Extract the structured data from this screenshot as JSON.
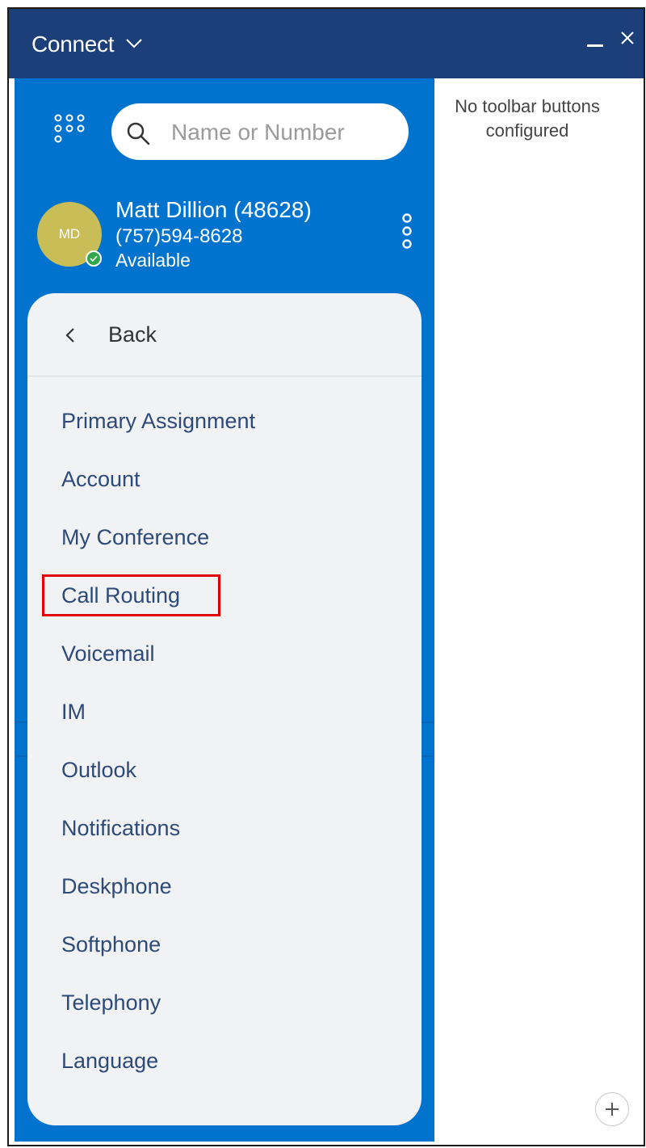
{
  "window": {
    "title": "Connect",
    "colors": {
      "titlebar": "#1c3f7a",
      "panel": "#0073cf",
      "menu_bg": "#f1f2f4",
      "menu_text": "#2d4a78",
      "highlight": "#e00000",
      "presence": "#2ea84a"
    }
  },
  "search": {
    "placeholder": "Name or Number",
    "icon": "search-icon"
  },
  "user": {
    "initials": "MD",
    "name": "Matt Dillion (48628)",
    "phone": "(757)594-8628",
    "status": "Available"
  },
  "menu": {
    "back_label": "Back",
    "items": [
      {
        "label": "Primary Assignment"
      },
      {
        "label": "Account"
      },
      {
        "label": "My Conference"
      },
      {
        "label": "Call Routing",
        "highlighted": true
      },
      {
        "label": "Voicemail"
      },
      {
        "label": "IM"
      },
      {
        "label": "Outlook"
      },
      {
        "label": "Notifications"
      },
      {
        "label": "Deskphone"
      },
      {
        "label": "Softphone"
      },
      {
        "label": "Telephony"
      },
      {
        "label": "Language"
      }
    ]
  },
  "toolbar": {
    "message": "No toolbar buttons configured"
  }
}
